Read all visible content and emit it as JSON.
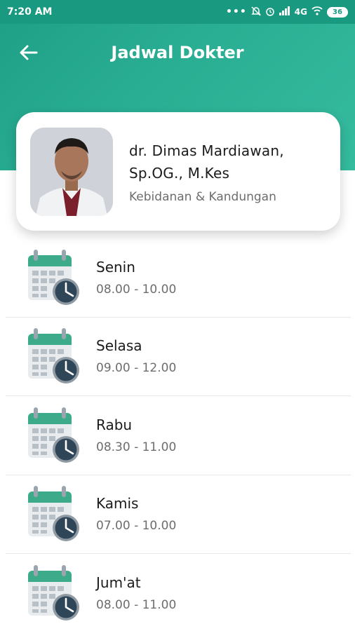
{
  "status_bar": {
    "time": "7:20 AM",
    "network": "4G",
    "battery": "36"
  },
  "app_bar": {
    "title": "Jadwal Dokter",
    "back_icon": "arrow-left-icon"
  },
  "doctor": {
    "name_line1": "dr. Dimas Mardiawan,",
    "name_line2": "Sp.OG., M.Kes",
    "specialty": "Kebidanan & Kandungan"
  },
  "schedule": [
    {
      "day": "Senin",
      "time": "08.00 - 10.00"
    },
    {
      "day": "Selasa",
      "time": "09.00 - 12.00"
    },
    {
      "day": "Rabu",
      "time": "08.30 - 11.00"
    },
    {
      "day": "Kamis",
      "time": "07.00 - 10.00"
    },
    {
      "day": "Jum'at",
      "time": "08.00 - 11.00"
    }
  ],
  "colors": {
    "primary": "#2aae93",
    "status_bar": "#199a80",
    "calendar_header": "#3dab8a",
    "clock": "#2f4659"
  }
}
